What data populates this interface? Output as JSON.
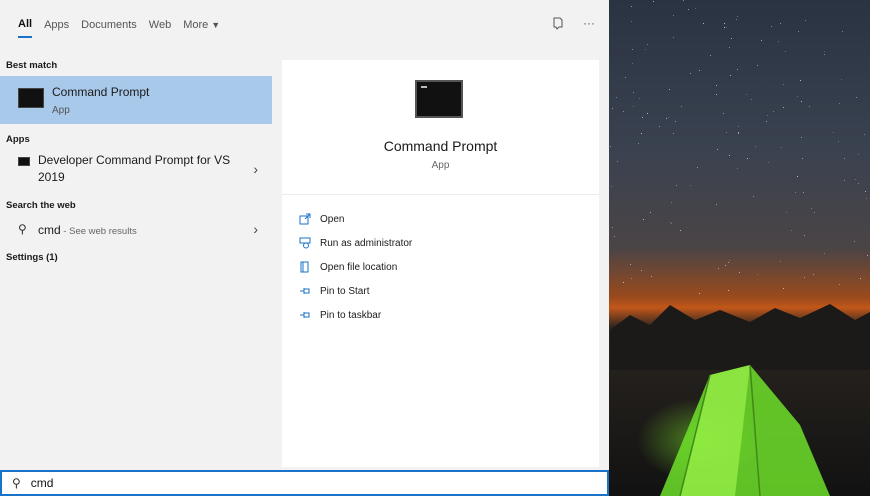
{
  "tabs": [
    {
      "label": "All"
    },
    {
      "label": "Apps"
    },
    {
      "label": "Documents"
    },
    {
      "label": "Web"
    },
    {
      "label": "More"
    }
  ],
  "best_match": {
    "heading": "Best match",
    "title": "Command Prompt",
    "subtitle": "App"
  },
  "apps": {
    "heading": "Apps",
    "line1": "Developer Command Prompt for VS",
    "line2": "2019"
  },
  "web": {
    "heading": "Search the web",
    "query": "cmd",
    "hint": " - See web results"
  },
  "settings": {
    "heading": "Settings (1)"
  },
  "detail": {
    "title": "Command Prompt",
    "subtitle": "App",
    "actions": [
      {
        "label": "Open",
        "icon": "open-icon"
      },
      {
        "label": "Run as administrator",
        "icon": "shield-admin-icon"
      },
      {
        "label": "Open file location",
        "icon": "file-location-icon"
      },
      {
        "label": "Pin to Start",
        "icon": "pin-icon"
      },
      {
        "label": "Pin to taskbar",
        "icon": "pin-icon"
      }
    ]
  },
  "search": {
    "value": "cmd"
  },
  "colors": {
    "accent": "#1a73c8",
    "selected": "#a9c9ea",
    "panel": "#f2f2f2"
  }
}
